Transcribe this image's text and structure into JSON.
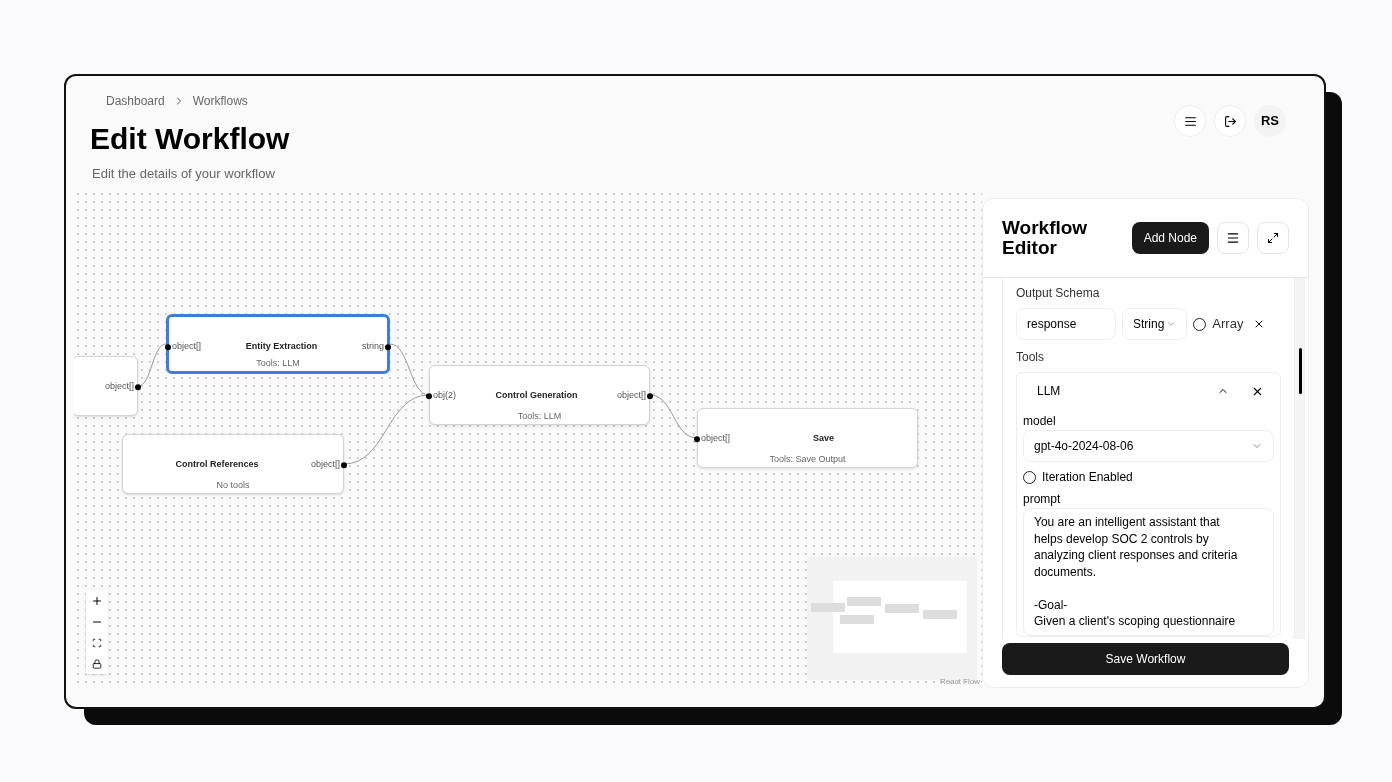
{
  "breadcrumb": [
    {
      "label": "Dashboard"
    },
    {
      "label": "Workflows"
    }
  ],
  "title": "Edit Workflow",
  "subtitle": "Edit the details of your workflow",
  "user": {
    "initials": "RS"
  },
  "canvas": {
    "nodes": [
      {
        "outputs": [
          "object[]"
        ],
        "selected": false
      },
      {
        "title": "Entity Extraction",
        "tools": "Tools: LLM",
        "inputs": [
          "object[]"
        ],
        "outputs": [
          "string"
        ],
        "selected": true
      },
      {
        "title": "Control References",
        "tools": "No tools",
        "outputs": [
          "object[]"
        ],
        "selected": false
      },
      {
        "title": "Control Generation",
        "tools": "Tools: LLM",
        "inputs": [
          "obj(2)"
        ],
        "outputs": [
          "object[]"
        ],
        "selected": false
      },
      {
        "title": "Save",
        "tools": "Tools: Save Output",
        "inputs": [
          "object[]"
        ],
        "selected": false
      }
    ],
    "attribution": "React Flow"
  },
  "panel": {
    "title": "Workflow Editor",
    "add_node_button": "Add Node",
    "output_schema": {
      "label": "Output Schema",
      "field_value": "response",
      "type": "String",
      "array": {
        "label": "Array",
        "checked": false
      }
    },
    "tools": {
      "label": "Tools",
      "items": [
        {
          "name": "LLM",
          "expanded": true,
          "model_label": "model",
          "model": "gpt-4o-2024-08-06",
          "iteration": {
            "label": "Iteration Enabled",
            "checked": false
          },
          "prompt_label": "prompt",
          "prompt": "You are an intelligent assistant that helps develop SOC 2 controls by analyzing client responses and criteria documents.\n\n-Goal-\nGiven a client's scoping questionnaire"
        }
      ]
    },
    "save_button": "Save Workflow"
  }
}
